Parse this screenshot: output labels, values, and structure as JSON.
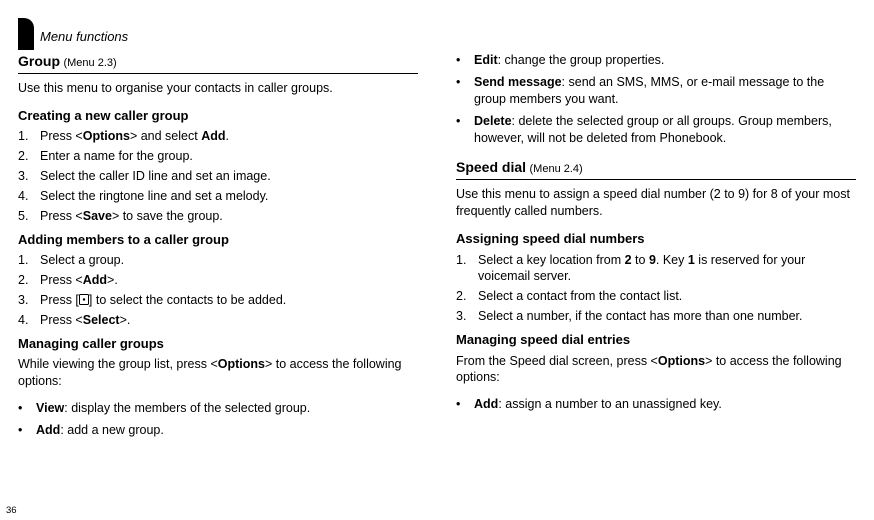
{
  "header": "Menu functions",
  "page_number": "36",
  "left": {
    "group": {
      "title": "Group",
      "tag": "(Menu 2.3)",
      "intro": "Use this menu to organise your contacts in caller groups.",
      "create": {
        "heading": "Creating a new caller group",
        "steps_num": [
          "1.",
          "2.",
          "3.",
          "4.",
          "5."
        ],
        "step1_a": "Press <",
        "step1_b": "Options",
        "step1_c": "> and select ",
        "step1_d": "Add",
        "step1_e": ".",
        "step2": "Enter a name for the group.",
        "step3": "Select the caller ID line and set an image.",
        "step4": "Select the ringtone line and set a melody.",
        "step5_a": "Press <",
        "step5_b": "Save",
        "step5_c": "> to save the group."
      },
      "add": {
        "heading": "Adding members to a caller group",
        "steps_num": [
          "1.",
          "2.",
          "3.",
          "4."
        ],
        "step1": "Select a group.",
        "step2_a": "Press <",
        "step2_b": "Add",
        "step2_c": ">.",
        "step3_a": "Press [",
        "step3_b": "] to select the contacts to be added.",
        "step4_a": "Press <",
        "step4_b": "Select",
        "step4_c": ">."
      },
      "manage": {
        "heading": "Managing caller groups",
        "intro_a": "While viewing the group list, press <",
        "intro_b": "Options",
        "intro_c": "> to access the following options:",
        "bullets": {
          "view_lbl": "View",
          "view_txt": ": display the members of the selected group.",
          "add_lbl": "Add",
          "add_txt": ": add a new group."
        }
      }
    }
  },
  "right": {
    "group_cont": {
      "edit_lbl": "Edit",
      "edit_txt": ": change the group properties.",
      "send_lbl": "Send message",
      "send_txt": ": send an SMS, MMS, or e-mail message to the group members you want.",
      "del_lbl": "Delete",
      "del_txt": ": delete the selected group or all groups. Group members, however, will not be deleted from Phonebook."
    },
    "speed": {
      "title": "Speed dial",
      "tag": "(Menu 2.4)",
      "intro": "Use this menu to assign a speed dial number (2 to 9) for 8 of your most frequently called numbers.",
      "assign": {
        "heading": "Assigning speed dial numbers",
        "steps_num": [
          "1.",
          "2.",
          "3."
        ],
        "step1_a": "Select a key location from ",
        "step1_b": "2",
        "step1_c": " to ",
        "step1_d": "9",
        "step1_e": ". Key ",
        "step1_f": "1",
        "step1_g": " is reserved for your voicemail server.",
        "step2": "Select a contact from the contact list.",
        "step3": "Select a number, if the contact has more than one number."
      },
      "manage": {
        "heading": "Managing speed dial entries",
        "intro_a": "From the Speed dial screen, press <",
        "intro_b": "Options",
        "intro_c": "> to access the following options:",
        "add_lbl": "Add",
        "add_txt": ": assign a number to an unassigned key."
      }
    }
  }
}
